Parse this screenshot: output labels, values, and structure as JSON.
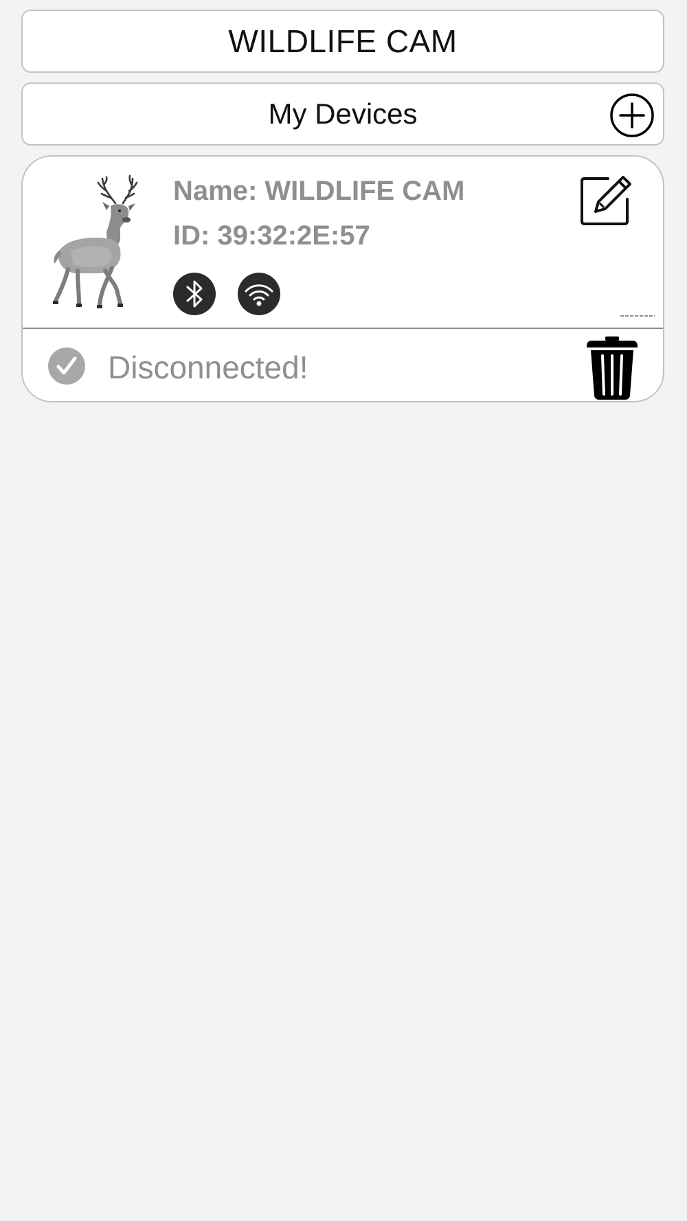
{
  "header": {
    "title": "WILDLIFE CAM"
  },
  "devices_bar": {
    "label": "My Devices",
    "add_icon": "plus-circle-icon"
  },
  "devices": [
    {
      "name_label": "Name: WILDLIFE CAM",
      "id_label": "ID: 39:32:2E:57",
      "image": "deer-image",
      "connectivity_icons": [
        "bluetooth-icon",
        "wifi-icon"
      ],
      "edit_icon": "edit-icon",
      "status": "Disconnected!",
      "status_icon": "check-circle-icon",
      "delete_icon": "trash-icon"
    }
  ],
  "colors": {
    "background": "#f3f3f3",
    "card": "#ffffff",
    "border": "#c3c3c3",
    "muted_text": "#8f8f8f",
    "icon_dark": "#2b2b2b"
  }
}
